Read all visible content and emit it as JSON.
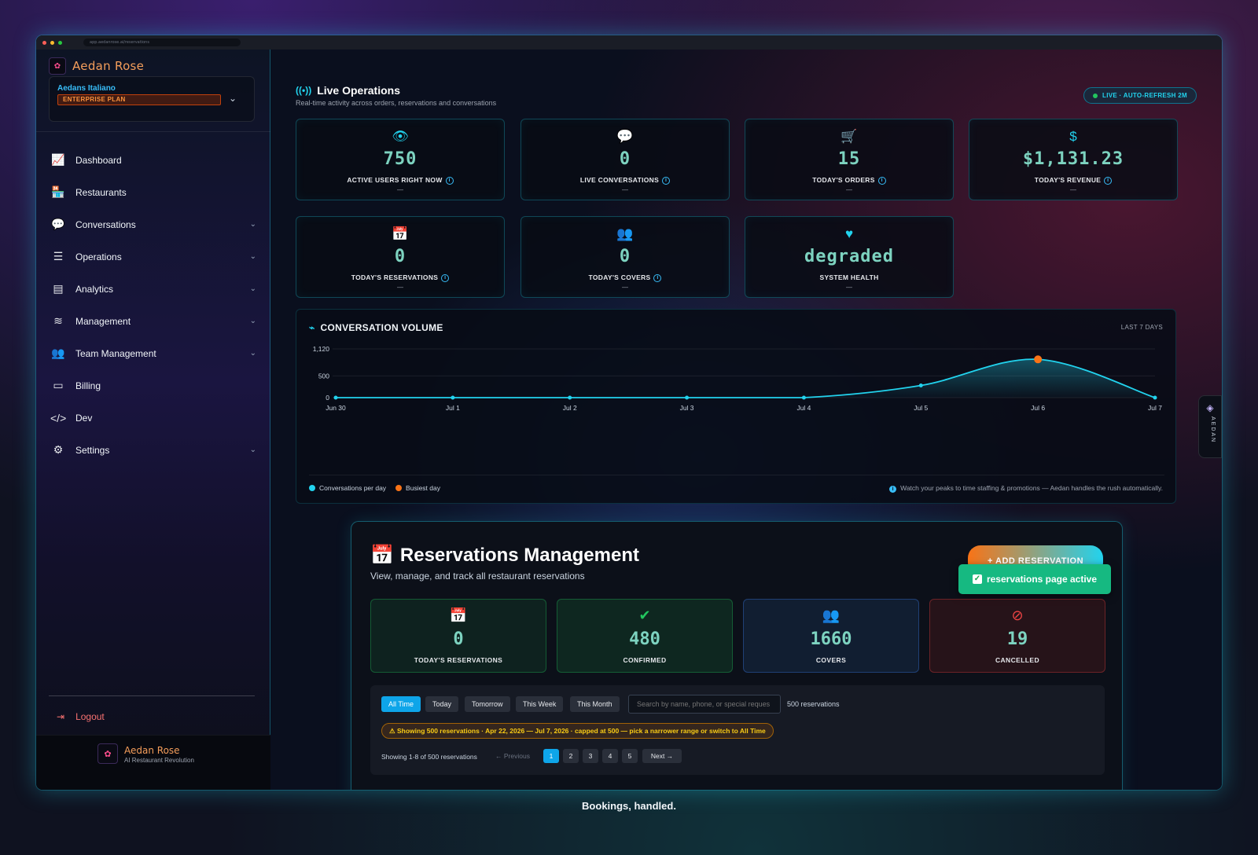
{
  "browser": {
    "url": "app.aedanrose.ai/reservations"
  },
  "sidebar": {
    "brand": "Aedan Rose",
    "org": {
      "name": "Aedans Italiano",
      "plan": "ENTERPRISE PLAN"
    },
    "items": [
      {
        "label": "Dashboard",
        "icon": "chart-line-icon",
        "glyph": "📈",
        "chevron": false
      },
      {
        "label": "Restaurants",
        "icon": "store-icon",
        "glyph": "🏪",
        "chevron": false
      },
      {
        "label": "Conversations",
        "icon": "chat-bubbles-icon",
        "glyph": "💬",
        "chevron": true
      },
      {
        "label": "Operations",
        "icon": "tasks-list-icon",
        "glyph": "☰",
        "chevron": true
      },
      {
        "label": "Analytics",
        "icon": "bar-chart-icon",
        "glyph": "▤",
        "chevron": true
      },
      {
        "label": "Management",
        "icon": "database-icon",
        "glyph": "≋",
        "chevron": true
      },
      {
        "label": "Team Management",
        "icon": "users-icon",
        "glyph": "👥",
        "chevron": true
      },
      {
        "label": "Billing",
        "icon": "credit-card-icon",
        "glyph": "▭",
        "chevron": false
      },
      {
        "label": "Dev",
        "icon": "code-icon",
        "glyph": "</>",
        "chevron": false
      },
      {
        "label": "Settings",
        "icon": "gear-icon",
        "glyph": "⚙",
        "chevron": true
      }
    ],
    "logout": "Logout",
    "footer": {
      "name": "Aedan Rose",
      "tagline": "AI Restaurant Revolution"
    }
  },
  "live_ops": {
    "title": "Live Operations",
    "subtitle": "Real-time activity across orders, reservations and conversations",
    "badge": "LIVE · AUTO-REFRESH 2M",
    "stats": [
      {
        "value": "750",
        "label": "ACTIVE USERS RIGHT NOW",
        "icon": "eye-icon",
        "glyph": "👁",
        "info": true,
        "sub": "—"
      },
      {
        "value": "0",
        "label": "LIVE CONVERSATIONS",
        "icon": "comment-icon",
        "glyph": "💬",
        "info": true,
        "sub": "—"
      },
      {
        "value": "15",
        "label": "TODAY'S ORDERS",
        "icon": "cart-icon",
        "glyph": "🛒",
        "info": true,
        "sub": "—"
      },
      {
        "value": "$1,131.23",
        "label": "TODAY'S REVENUE",
        "icon": "dollar-icon",
        "glyph": "$",
        "info": true,
        "sub": "—"
      },
      {
        "value": "0",
        "label": "TODAY'S RESERVATIONS",
        "icon": "calendar-check-icon",
        "glyph": "📅",
        "info": true,
        "sub": "—"
      },
      {
        "value": "0",
        "label": "TODAY'S COVERS",
        "icon": "users-icon",
        "glyph": "👥",
        "info": true,
        "sub": "—"
      },
      {
        "value": "degraded",
        "label": "SYSTEM HEALTH",
        "icon": "heart-pulse-icon",
        "glyph": "♥",
        "info": false,
        "sub": "—"
      }
    ]
  },
  "chart_data": {
    "type": "area",
    "title": "CONVERSATION VOLUME",
    "range_label": "LAST 7 DAYS",
    "categories": [
      "Jun 30",
      "Jul 1",
      "Jul 2",
      "Jul 3",
      "Jul 4",
      "Jul 5",
      "Jul 6",
      "Jul 7"
    ],
    "series": [
      {
        "name": "Conversations per day",
        "values": [
          0,
          0,
          0,
          0,
          0,
          280,
          880,
          0
        ],
        "color": "#22d3ee"
      }
    ],
    "highlight": {
      "name": "Busiest day",
      "category": "Jul 6",
      "value": 880,
      "color": "#f97316"
    },
    "yticks": [
      "0",
      "500",
      "1,120"
    ],
    "ylim": [
      0,
      1120
    ],
    "grid": true,
    "legend": "bottom-left",
    "note": "Watch your peaks to time staffing & promotions — Aedan handles the rush automatically."
  },
  "reservations": {
    "title": "Reservations Management",
    "subtitle": "View, manage, and track all restaurant reservations",
    "add_button": "+ ADD RESERVATION",
    "toast": "reservations page active",
    "stats": [
      {
        "value": "0",
        "label": "TODAY'S RESERVATIONS",
        "icon": "calendar-check-icon",
        "glyph": "📅",
        "color": "#22c55e"
      },
      {
        "value": "480",
        "label": "CONFIRMED",
        "icon": "check-circle-icon",
        "glyph": "✔",
        "color": "#22c55e"
      },
      {
        "value": "1660",
        "label": "COVERS",
        "icon": "users-icon",
        "glyph": "👥",
        "color": "#3b82f6"
      },
      {
        "value": "19",
        "label": "CANCELLED",
        "icon": "ban-icon",
        "glyph": "⊘",
        "color": "#ef4444"
      }
    ],
    "filters": [
      "All Time",
      "Today",
      "Tomorrow",
      "This Week",
      "This Month"
    ],
    "active_filter": "All Time",
    "search_placeholder": "Search by name, phone, or special reques",
    "count": "500 reservations",
    "warning": "⚠ Showing 500 reservations · Apr 22, 2026 — Jul 7, 2026 · capped at 500 — pick a narrower range or switch to All Time",
    "pagination": {
      "info": "Showing 1-8 of 500 reservations",
      "prev": "← Previous",
      "pages": [
        "1",
        "2",
        "3",
        "4",
        "5"
      ],
      "active": "1",
      "next": "Next →"
    }
  },
  "rail": {
    "label": "AEDAN"
  },
  "caption": "Bookings, handled."
}
